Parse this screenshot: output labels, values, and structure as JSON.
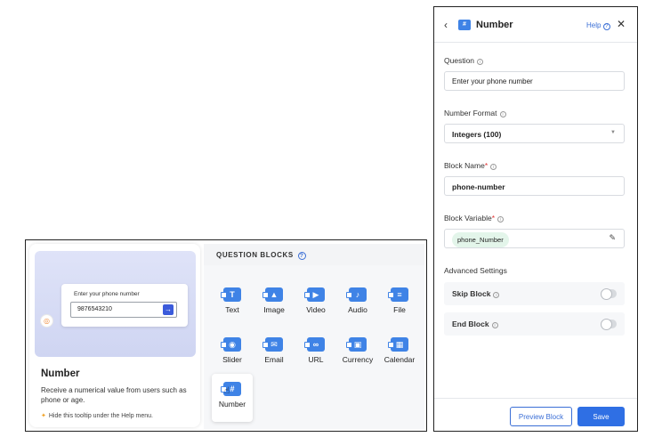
{
  "tooltip": {
    "preview_label": "Enter your phone number",
    "preview_value": "9876543210",
    "title": "Number",
    "description": "Receive a numerical value from users such as phone or age.",
    "hint": "Hide this tooltip under the Help menu."
  },
  "blocks": {
    "header": "QUESTION BLOCKS",
    "items": [
      {
        "label": "Text",
        "icon": "T"
      },
      {
        "label": "Image",
        "icon": "▲"
      },
      {
        "label": "Video",
        "icon": "▶"
      },
      {
        "label": "Audio",
        "icon": "♪"
      },
      {
        "label": "File",
        "icon": "≡"
      },
      {
        "label": "Slider",
        "icon": "◉"
      },
      {
        "label": "Email",
        "icon": "✉"
      },
      {
        "label": "URL",
        "icon": "∞"
      },
      {
        "label": "Currency",
        "icon": "▣"
      },
      {
        "label": "Calendar",
        "icon": "▦"
      },
      {
        "label": "Number",
        "icon": "#"
      }
    ]
  },
  "panel": {
    "title": "Number",
    "help_label": "Help",
    "question_label": "Question",
    "question_value": "Enter your phone number",
    "format_label": "Number Format",
    "format_value": "Integers (100)",
    "name_label": "Block Name",
    "name_value": "phone-number",
    "variable_label": "Block Variable",
    "variable_value": "phone_Number",
    "advanced_label": "Advanced Settings",
    "skip_label": "Skip Block",
    "skip_enabled": false,
    "end_label": "End Block",
    "end_enabled": false,
    "preview_button": "Preview Block",
    "save_button": "Save"
  },
  "colors": {
    "accent": "#2f6fe4",
    "block_icon": "#3f83e6",
    "variable_chip": "#e3f5ea"
  }
}
